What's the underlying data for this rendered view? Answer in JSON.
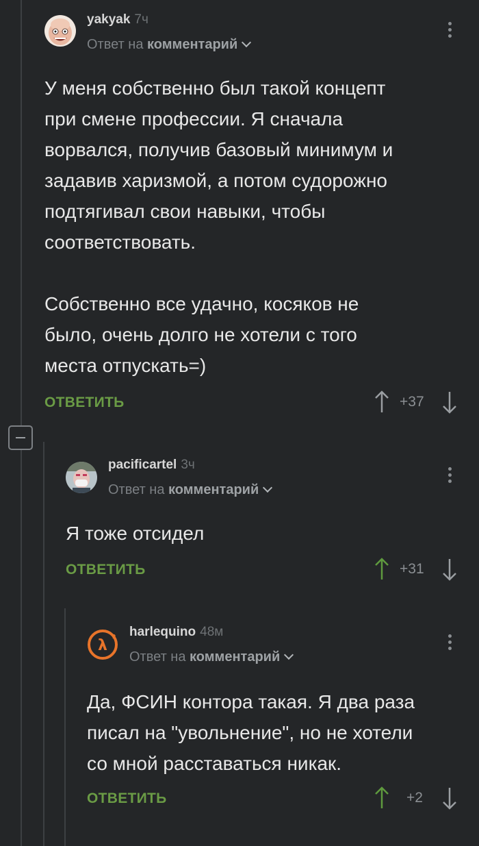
{
  "comments": [
    {
      "username": "yakyak",
      "time": "7ч",
      "reply_prefix": "Ответ на",
      "reply_target": "комментарий",
      "text_lines": [
        "У меня собственно был такой концепт",
        "при смене профессии. Я сначала",
        "ворвался, получив базовый минимум и",
        "задавив харизмой, а потом судорожно",
        "подтягивал свои навыки, чтобы",
        "соответствовать."
      ],
      "text_lines_2": [
        "Собственно все удачно, косяков не",
        "было, очень долго не хотели с того",
        "места отпускать=)"
      ],
      "reply_label": "ОТВЕТИТЬ",
      "score": "+37",
      "avatar": "avatar-bald-face"
    },
    {
      "username": "pacificartel",
      "time": "3ч",
      "reply_prefix": "Ответ на",
      "reply_target": "комментарий",
      "text_lines": [
        "Я тоже отсидел"
      ],
      "reply_label": "ОТВЕТИТЬ",
      "score": "+31",
      "avatar": "avatar-mask-face"
    },
    {
      "username": "harlequino",
      "time": "48м",
      "reply_prefix": "Ответ на",
      "reply_target": "комментарий",
      "text_lines": [
        "Да, ФСИН контора такая. Я два раза",
        "писал на \"увольнение\", но не хотели",
        "со мной расставаться никак."
      ],
      "reply_label": "ОТВЕТИТЬ",
      "score": "+2",
      "avatar": "avatar-half-life-logo"
    }
  ],
  "colors": {
    "background": "#242628",
    "reply_green": "#6a9b45",
    "upvote_active": "#5f9a3e"
  }
}
